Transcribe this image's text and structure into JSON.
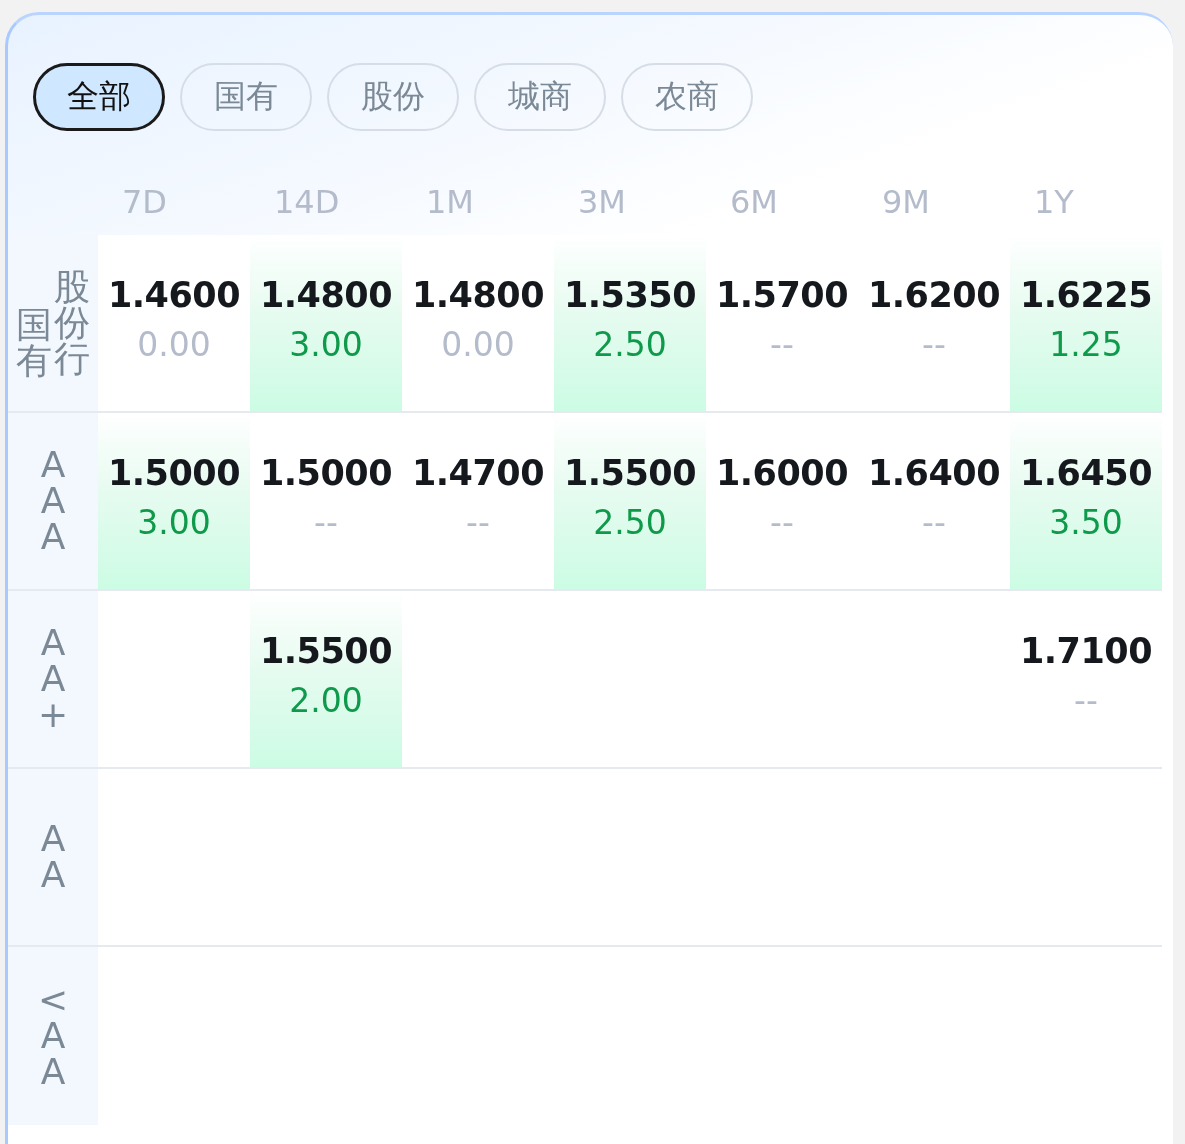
{
  "filters": [
    {
      "label": "全部",
      "selected": true
    },
    {
      "label": "国有",
      "selected": false
    },
    {
      "label": "股份",
      "selected": false
    },
    {
      "label": "城商",
      "selected": false
    },
    {
      "label": "农商",
      "selected": false
    }
  ],
  "columns": [
    "7D",
    "14D",
    "1M",
    "3M",
    "6M",
    "9M",
    "1Y"
  ],
  "rows": [
    {
      "label_columns": [
        "国有",
        "股份行"
      ],
      "cells": [
        {
          "rate": "1.4600",
          "change": "0.00",
          "up": false,
          "highlighted": false
        },
        {
          "rate": "1.4800",
          "change": "3.00",
          "up": true,
          "highlighted": true
        },
        {
          "rate": "1.4800",
          "change": "0.00",
          "up": false,
          "highlighted": false
        },
        {
          "rate": "1.5350",
          "change": "2.50",
          "up": true,
          "highlighted": true
        },
        {
          "rate": "1.5700",
          "change": "--",
          "up": false,
          "highlighted": false
        },
        {
          "rate": "1.6200",
          "change": "--",
          "up": false,
          "highlighted": false
        },
        {
          "rate": "1.6225",
          "change": "1.25",
          "up": true,
          "highlighted": true
        }
      ]
    },
    {
      "label_columns": [
        "AAA"
      ],
      "cells": [
        {
          "rate": "1.5000",
          "change": "3.00",
          "up": true,
          "highlighted": true
        },
        {
          "rate": "1.5000",
          "change": "--",
          "up": false,
          "highlighted": false
        },
        {
          "rate": "1.4700",
          "change": "--",
          "up": false,
          "highlighted": false
        },
        {
          "rate": "1.5500",
          "change": "2.50",
          "up": true,
          "highlighted": true
        },
        {
          "rate": "1.6000",
          "change": "--",
          "up": false,
          "highlighted": false
        },
        {
          "rate": "1.6400",
          "change": "--",
          "up": false,
          "highlighted": false
        },
        {
          "rate": "1.6450",
          "change": "3.50",
          "up": true,
          "highlighted": true
        }
      ]
    },
    {
      "label_columns": [
        "AA+"
      ],
      "cells": [
        null,
        {
          "rate": "1.5500",
          "change": "2.00",
          "up": true,
          "highlighted": true
        },
        null,
        null,
        null,
        null,
        {
          "rate": "1.7100",
          "change": "--",
          "up": false,
          "highlighted": false
        }
      ]
    },
    {
      "label_columns": [
        "AA"
      ],
      "cells": [
        null,
        null,
        null,
        null,
        null,
        null,
        null
      ]
    },
    {
      "label_columns": [
        "<AA"
      ],
      "cells": [
        null,
        null,
        null,
        null,
        null,
        null,
        null
      ]
    }
  ]
}
